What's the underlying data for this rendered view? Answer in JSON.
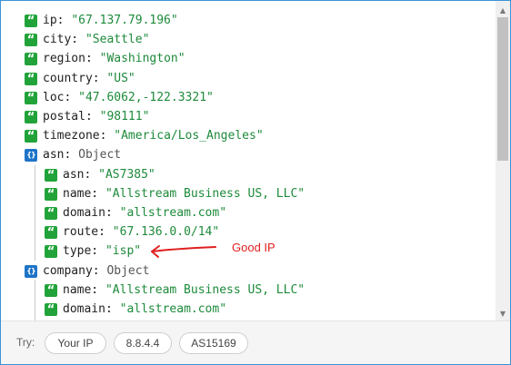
{
  "json_viewer": {
    "rows": [
      {
        "key": "ip:",
        "value": "\"67.137.79.196\"",
        "kind": "string"
      },
      {
        "key": "city:",
        "value": "\"Seattle\"",
        "kind": "string"
      },
      {
        "key": "region:",
        "value": "\"Washington\"",
        "kind": "string"
      },
      {
        "key": "country:",
        "value": "\"US\"",
        "kind": "string"
      },
      {
        "key": "loc:",
        "value": "\"47.6062,-122.3321\"",
        "kind": "string"
      },
      {
        "key": "postal:",
        "value": "\"98111\"",
        "kind": "string"
      },
      {
        "key": "timezone:",
        "value": "\"America/Los_Angeles\"",
        "kind": "string"
      },
      {
        "key": "asn:",
        "value": "Object",
        "kind": "object"
      },
      {
        "key": "asn:",
        "value": "\"AS7385\"",
        "kind": "string"
      },
      {
        "key": "name:",
        "value": "\"Allstream Business US, LLC\"",
        "kind": "string"
      },
      {
        "key": "domain:",
        "value": "\"allstream.com\"",
        "kind": "string"
      },
      {
        "key": "route:",
        "value": "\"67.136.0.0/14\"",
        "kind": "string"
      },
      {
        "key": "type:",
        "value": "\"isp\"",
        "kind": "string"
      },
      {
        "key": "company:",
        "value": "Object",
        "kind": "object"
      },
      {
        "key": "name:",
        "value": "\"Allstream Business US, LLC\"",
        "kind": "string"
      },
      {
        "key": "domain:",
        "value": "\"allstream.com\"",
        "kind": "string"
      }
    ],
    "badge_glyphs": {
      "string": "“",
      "object": "{}"
    },
    "badge_icons": {
      "string": "quote-icon",
      "object": "object-braces-icon"
    }
  },
  "annotation": {
    "text": "Good IP",
    "color": "#e02020"
  },
  "footer": {
    "try_label": "Try:",
    "chips": [
      "Your IP",
      "8.8.4.4",
      "AS15169"
    ]
  },
  "colors": {
    "string_badge": "#21a33a",
    "object_badge": "#1e74c8",
    "string_value": "#1d8a3a",
    "window_border": "#3b93d6"
  }
}
